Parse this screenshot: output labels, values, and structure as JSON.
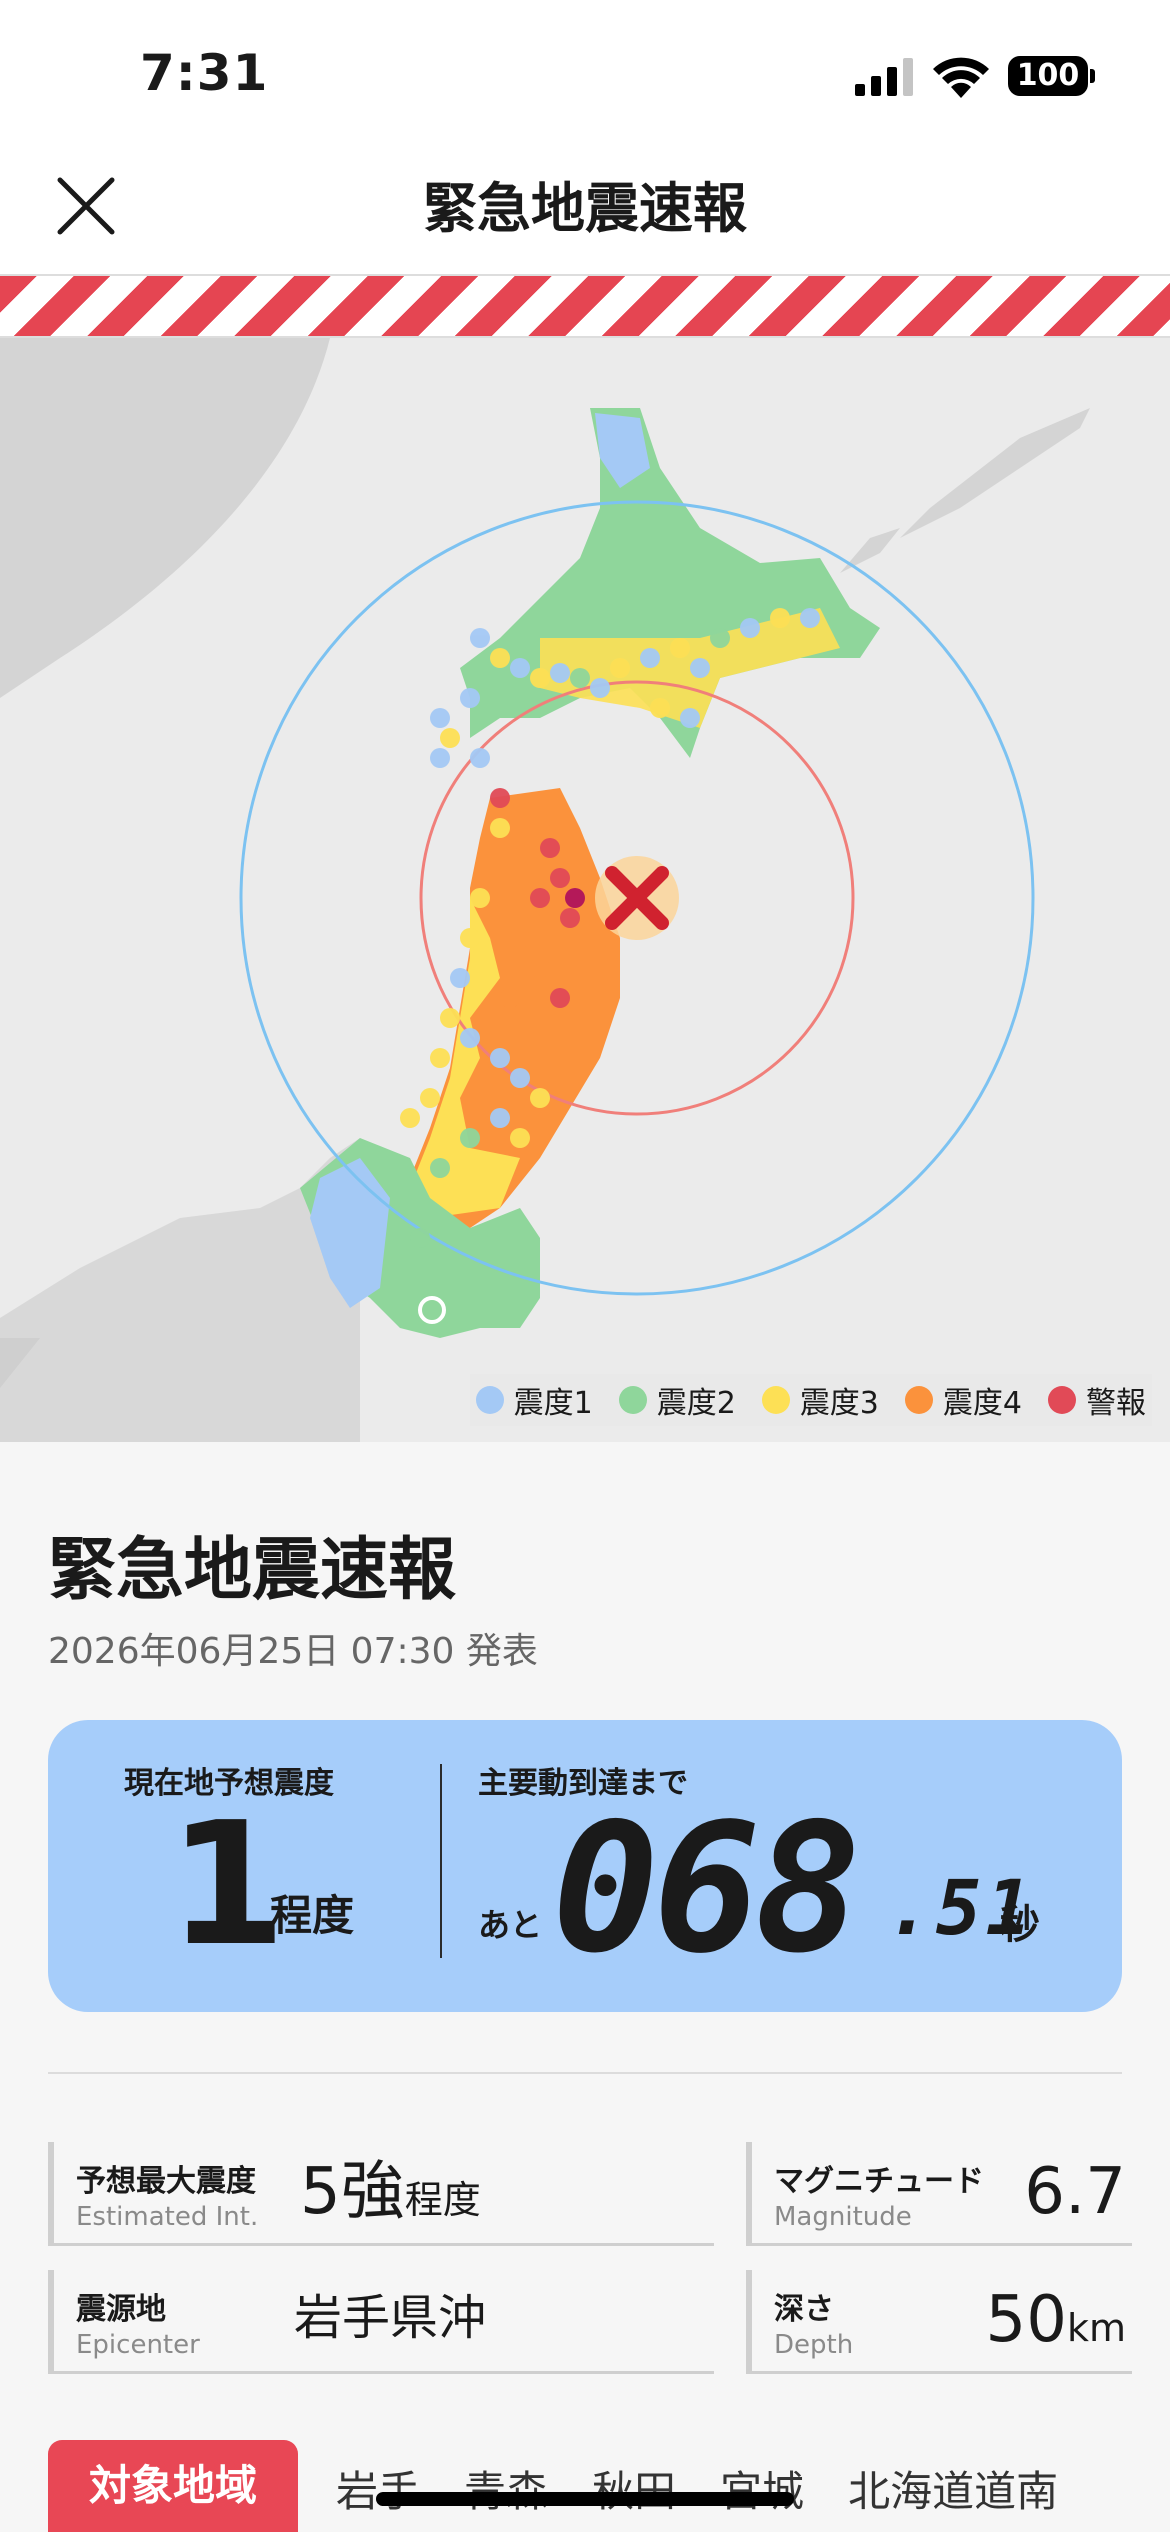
{
  "status_bar": {
    "time": "7:31",
    "battery": "100"
  },
  "header": {
    "title": "緊急地震速報",
    "close_icon": "close-icon"
  },
  "map": {
    "legend": [
      {
        "label": "震度1",
        "color": "#a4c9f5"
      },
      {
        "label": "震度2",
        "color": "#8fd69b"
      },
      {
        "label": "震度3",
        "color": "#fde055"
      },
      {
        "label": "震度4",
        "color": "#fb923c"
      },
      {
        "label": "警報",
        "color": "#e14a57"
      }
    ],
    "epicenter_icon": "epicenter-x-icon",
    "current_location_icon": "location-icon"
  },
  "info": {
    "title": "緊急地震速報",
    "issued": "2026年06月25日 07:30 発表",
    "card": {
      "local_label": "現在地予想震度",
      "local_intensity": "1",
      "local_unit": "程度",
      "arrival_label": "主要動到達まで",
      "arrival_prefix": "あと",
      "arrival_main": "068",
      "arrival_fraction": ".51",
      "arrival_unit": "秒"
    },
    "stats": {
      "max_int": {
        "label": "予想最大震度",
        "sub": "Estimated Int.",
        "value": "5強",
        "unit": "程度"
      },
      "magnitude": {
        "label": "マグニチュード",
        "sub": "Magnitude",
        "value": "6.7"
      },
      "epicenter": {
        "label": "震源地",
        "sub": "Epicenter",
        "value": "岩手県沖"
      },
      "depth": {
        "label": "深さ",
        "sub": "Depth",
        "value": "50",
        "unit": "km"
      }
    },
    "target_label": "対象地域",
    "regions": [
      "岩手",
      "青森",
      "秋田",
      "宮城",
      "北海道道南"
    ]
  }
}
